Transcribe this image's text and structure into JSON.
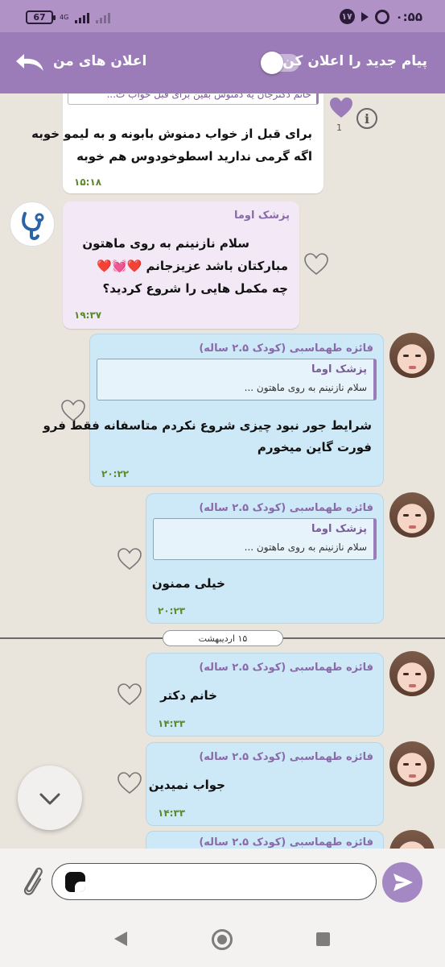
{
  "status_bar": {
    "battery": "67",
    "network": "4G",
    "notification_count": "۱۷",
    "time": "۰:۵۵"
  },
  "header": {
    "title": "اعلان های من",
    "toggle_label": "پیام جدید را اعلان کن",
    "toggle_on": false
  },
  "messages": [
    {
      "id": "m0",
      "quote_preview": "خانم دکترجان یه دمنوش بفین برای قبل خواب ت...",
      "lines": [
        "برای قبل از خواب دمنوش بابونه و به لیمو خوبه",
        "اگه گرمی ندارید اسطوخودوس هم خوبه"
      ],
      "time": "۱۵:۱۸",
      "likes": "1"
    },
    {
      "id": "m1",
      "sender": "پزشک اوما",
      "lines": [
        "سلام نازنینم به روی ماهتون",
        "مبارکتان باشد عزیزجانم ❤️💓❤️",
        "چه مکمل هایی را شروع کردید؟"
      ],
      "time": "۱۹:۳۷"
    },
    {
      "id": "m2",
      "sender": "فائزه طهماسبی (کودک ۲.۵ ساله)",
      "quote": {
        "name": "پزشک اوما",
        "text": "سلام نازنینم به روی ماهتون ..."
      },
      "lines": [
        "شرایط جور نبود چیزی شروع نکردم متاسفانه فقط  فرو",
        "فورت گاین میخورم"
      ],
      "time": "۲۰:۲۲"
    },
    {
      "id": "m3",
      "sender": "فائزه طهماسبی (کودک ۲.۵ ساله)",
      "quote": {
        "name": "پزشک اوما",
        "text": "سلام نازنینم به روی ماهتون ..."
      },
      "lines": [
        "خیلی ممنون"
      ],
      "time": "۲۰:۲۳"
    },
    {
      "id": "m4",
      "sender": "فائزه طهماسبی (کودک ۲.۵ ساله)",
      "lines": [
        "خانم دکتر"
      ],
      "time": "۱۴:۳۳"
    },
    {
      "id": "m5",
      "sender": "فائزه طهماسبی (کودک ۲.۵ ساله)",
      "lines": [
        "جواب نمیدین"
      ],
      "time": "۱۴:۳۳"
    },
    {
      "id": "m6",
      "sender": "فائزه طهماسبی (کودک ۲.۵ ساله)"
    }
  ],
  "date_separator": "۱۵ اردیبهشت",
  "colors": {
    "header": "#9b7cb8",
    "status_bar": "#b092c6",
    "bubble_user": "#cde8f6",
    "bubble_doctor": "#f2e8f6",
    "time_text": "#5a8a2a",
    "send_button": "#a488c4"
  },
  "icons": {
    "back": "back-arrow-icon",
    "info": "info-icon",
    "heart": "heart-outline-icon",
    "attach": "paperclip-icon",
    "send": "send-icon",
    "scroll": "chevron-down-icon"
  }
}
